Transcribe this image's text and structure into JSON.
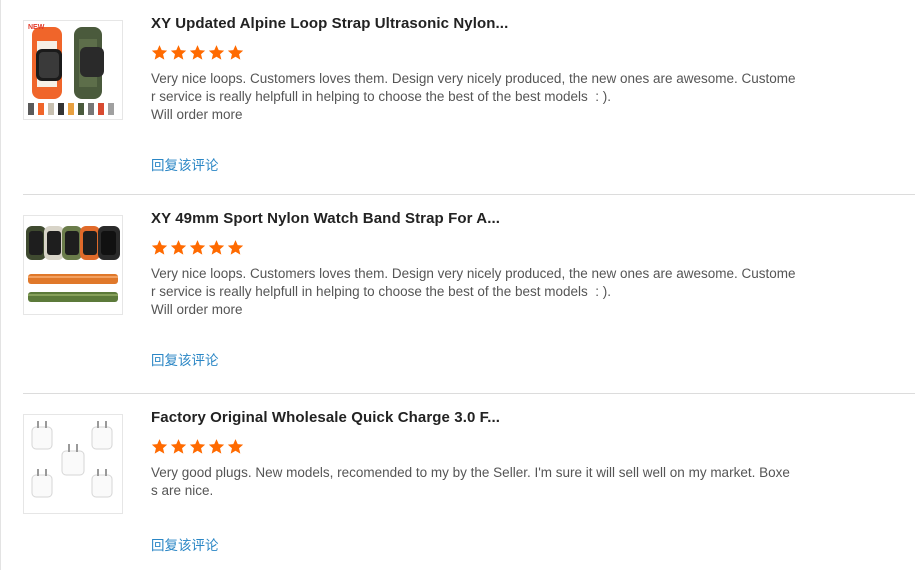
{
  "colors": {
    "star": "#ff6a00",
    "link": "#2a86c5",
    "title": "#222222",
    "text": "#555555"
  },
  "reviews": [
    {
      "title": "XY Updated Alpine Loop Strap Ultrasonic Nylon...",
      "rating": 5,
      "comment_lines": [
        "Very nice loops. Customers loves them. Design very nicely produced, the new ones are awesome. Custome",
        "r service is really helpfull in helping to choose the best of the best models  : ).",
        "Will order more"
      ],
      "reply_label": "回复该评论",
      "thumb": {
        "badge": "NEW"
      }
    },
    {
      "title": "XY 49mm Sport Nylon Watch Band Strap For A...",
      "rating": 5,
      "comment_lines": [
        "Very nice loops. Customers loves them. Design very nicely produced, the new ones are awesome. Custome",
        "r service is really helpfull in helping to choose the best of the best models  : ).",
        "Will order more"
      ],
      "reply_label": "回复该评论"
    },
    {
      "title": "Factory Original Wholesale Quick Charge 3.0 F...",
      "rating": 5,
      "comment_lines": [
        "Very good plugs. New models, recomended to my by the Seller. I'm sure it will sell well on my market. Boxe",
        "s are nice."
      ],
      "reply_label": "回复该评论"
    }
  ]
}
